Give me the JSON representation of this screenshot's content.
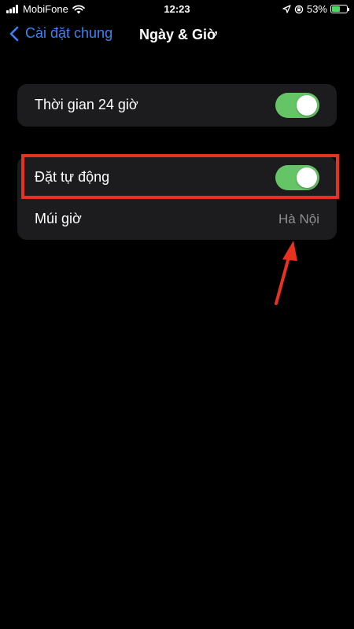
{
  "status_bar": {
    "carrier": "MobiFone",
    "time": "12:23",
    "battery_percent": "53%",
    "battery_level": 0.53,
    "battery_color": "#4cd964",
    "icons": [
      "signal-icon",
      "wifi-icon",
      "location-icon",
      "orientation-lock-icon",
      "battery-icon"
    ]
  },
  "nav": {
    "back_label": "Cài đặt chung",
    "title": "Ngày & Giờ",
    "accent_color": "#3a82f7"
  },
  "settings": {
    "time_24h": {
      "label": "Thời gian 24 giờ",
      "enabled": true
    },
    "set_automatically": {
      "label": "Đặt tự động",
      "enabled": true
    },
    "time_zone": {
      "label": "Múi giờ",
      "value": "Hà Nội"
    }
  },
  "colors": {
    "toggle_on": "#65c466",
    "annotation": "#e8321f"
  }
}
